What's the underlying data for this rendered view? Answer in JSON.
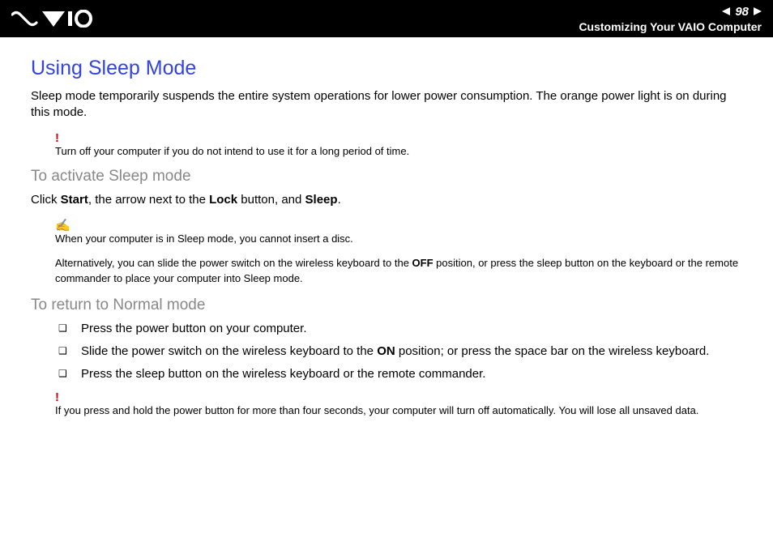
{
  "header": {
    "page_number": "98",
    "section": "Customizing Your VAIO Computer"
  },
  "main": {
    "title": "Using Sleep Mode",
    "intro": "Sleep mode temporarily suspends the entire system operations for lower power consumption. The orange power light is on during this mode.",
    "warning1": "Turn off your computer if you do not intend to use it for a long period of time.",
    "activate": {
      "heading": "To activate Sleep mode",
      "click_text_pre": "Click ",
      "start": "Start",
      "click_text_mid1": ", the arrow next to the ",
      "lock": "Lock",
      "click_text_mid2": " button, and ",
      "sleep": "Sleep",
      "click_text_post": ".",
      "note1": "When your computer is in Sleep mode, you cannot insert a disc.",
      "alt_pre": "Alternatively, you can slide the power switch on the wireless keyboard to the ",
      "off": "OFF",
      "alt_post": " position, or press the sleep button on the keyboard or the remote commander to place your computer into Sleep mode."
    },
    "return": {
      "heading": "To return to Normal mode",
      "bullets": {
        "b1": "Press the power button on your computer.",
        "b2_pre": "Slide the power switch on the wireless keyboard to the ",
        "b2_on": "ON",
        "b2_post": " position; or press the space bar on the wireless keyboard.",
        "b3": "Press the sleep button on the wireless keyboard or the remote commander."
      },
      "warning2": "If you press and hold the power button for more than four seconds, your computer will turn off automatically. You will lose all unsaved data."
    }
  }
}
